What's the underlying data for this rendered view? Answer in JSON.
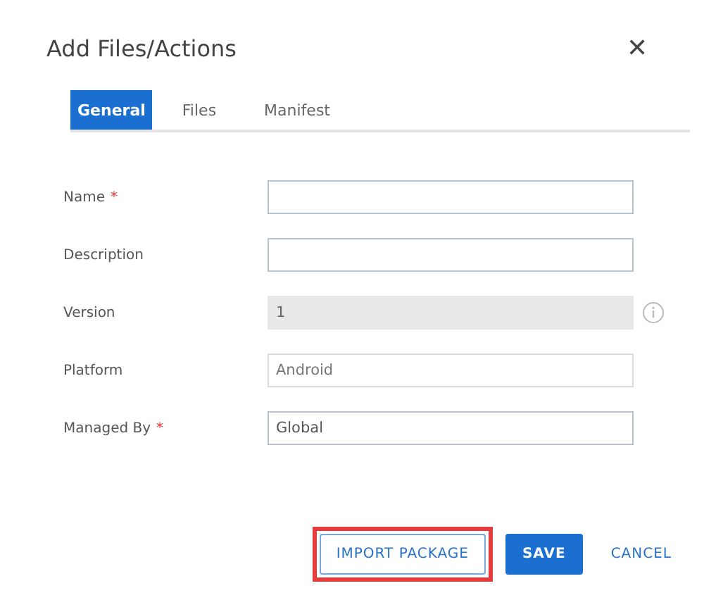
{
  "window": {
    "title": "Add Files/Actions",
    "close": "✕"
  },
  "tabs": [
    {
      "label": "General",
      "selected": true
    },
    {
      "label": "Files",
      "selected": false
    },
    {
      "label": "Manifest",
      "selected": false
    }
  ],
  "fields": [
    {
      "label": "Name",
      "required_mark": "*",
      "kind": "input"
    },
    {
      "label": "Description",
      "kind": "input"
    },
    {
      "label": "Version",
      "kind": "disabled",
      "value": "1",
      "info": true
    },
    {
      "label": "Platform",
      "kind": "readonly",
      "value": "Android"
    },
    {
      "label": "Managed By",
      "required_mark": "*",
      "kind": "input",
      "value": "Global"
    }
  ],
  "buttons": [
    {
      "label": "IMPORT PACKAGE",
      "kind": "outline",
      "highlighted": true
    },
    {
      "label": "SAVE",
      "kind": "primary",
      "highlighted": false
    },
    {
      "label": "CANCEL",
      "kind": "text",
      "highlighted": false
    }
  ]
}
